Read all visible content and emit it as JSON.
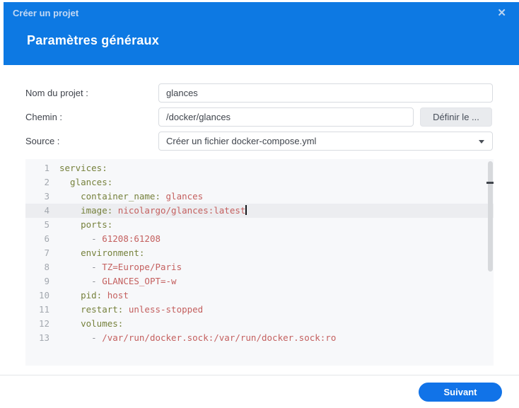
{
  "dialog": {
    "title": "Créer un projet",
    "subtitle": "Paramètres généraux",
    "close_icon": "✕"
  },
  "form": {
    "project_name": {
      "label": "Nom du projet :",
      "value": "glances"
    },
    "path": {
      "label": "Chemin :",
      "value": "/docker/glances",
      "button_label": "Définir le ..."
    },
    "source": {
      "label": "Source :",
      "selected_value": "Créer un fichier docker-compose.yml"
    }
  },
  "editor": {
    "active_line": 4,
    "lines": [
      {
        "n": "1",
        "parts": [
          [
            "key",
            "services:"
          ]
        ]
      },
      {
        "n": "2",
        "parts": [
          [
            "key",
            "  glances:"
          ]
        ]
      },
      {
        "n": "3",
        "parts": [
          [
            "key",
            "    container_name:"
          ],
          [
            "val",
            " glances"
          ]
        ]
      },
      {
        "n": "4",
        "parts": [
          [
            "key",
            "    image:"
          ],
          [
            "val",
            " nicolargo/glances:latest"
          ]
        ],
        "active": true,
        "cursor": true
      },
      {
        "n": "5",
        "parts": [
          [
            "key",
            "    ports:"
          ]
        ]
      },
      {
        "n": "6",
        "parts": [
          [
            "meta",
            "      - "
          ],
          [
            "val",
            "61208:61208"
          ]
        ]
      },
      {
        "n": "7",
        "parts": [
          [
            "key",
            "    environment:"
          ]
        ]
      },
      {
        "n": "8",
        "parts": [
          [
            "meta",
            "      - "
          ],
          [
            "val",
            "TZ=Europe/Paris"
          ]
        ]
      },
      {
        "n": "9",
        "parts": [
          [
            "meta",
            "      - "
          ],
          [
            "val",
            "GLANCES_OPT=-w"
          ]
        ]
      },
      {
        "n": "10",
        "parts": [
          [
            "key",
            "    pid:"
          ],
          [
            "val",
            " host"
          ]
        ]
      },
      {
        "n": "11",
        "parts": [
          [
            "key",
            "    restart:"
          ],
          [
            "val",
            " unless-stopped"
          ]
        ]
      },
      {
        "n": "12",
        "parts": [
          [
            "key",
            "    volumes:"
          ]
        ]
      },
      {
        "n": "13",
        "parts": [
          [
            "meta",
            "      - "
          ],
          [
            "val",
            "/var/run/docker.sock:/var/run/docker.sock:ro"
          ]
        ]
      }
    ]
  },
  "footer": {
    "next_label": "Suivant"
  },
  "colors": {
    "header_blue": "#0d79e3",
    "next_button_blue": "#1173e8",
    "yaml_key": "#76813c",
    "yaml_value": "#c4605f",
    "yaml_dash": "#8b8f96",
    "editor_background": "#f7f8fa",
    "active_line_background": "#ecedf0"
  }
}
